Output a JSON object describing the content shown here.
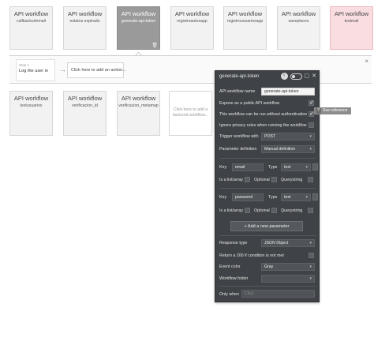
{
  "workflows_row1": [
    {
      "title": "API workflow",
      "name": "callbackurlemail",
      "style": "normal"
    },
    {
      "title": "API workflow",
      "name": "estatus expirado",
      "style": "normal"
    },
    {
      "title": "API workflow",
      "name": "generate-api-token",
      "style": "selected"
    },
    {
      "title": "API workflow",
      "name": "registroautosapp",
      "style": "normal"
    },
    {
      "title": "API workflow",
      "name": "registrousuariosapp",
      "style": "normal"
    },
    {
      "title": "API workflow",
      "name": "saveplaces",
      "style": "normal"
    },
    {
      "title": "API workflow",
      "name": "testmail",
      "style": "pink"
    }
  ],
  "workflows_row2": [
    {
      "title": "API workflow",
      "name": "testusuarios"
    },
    {
      "title": "API workflow",
      "name": "verificacion_id"
    },
    {
      "title": "API workflow",
      "name": "verificacion_metamap"
    }
  ],
  "add_backend_workflow": "Click here to add a backend workflow...",
  "steps_bar": {
    "step_label": "Step 1",
    "step_value": "Log the user in",
    "add_action": "Click here to add an action...",
    "close_glyph": "×"
  },
  "panel": {
    "title": "generate-api-token",
    "api_workflow_name_label": "API workflow name",
    "api_workflow_name_value": "generate-api-token",
    "expose_public_label": "Expose as a public API workflow",
    "expose_public_checked": true,
    "no_auth_label": "This workflow can be run without authentication",
    "no_auth_checked": true,
    "ignore_privacy_label": "Ignore privacy rules when running the workflow",
    "ignore_privacy_checked": false,
    "trigger_label": "Trigger workflow with",
    "trigger_value": "POST",
    "param_def_label": "Parameter definition",
    "param_def_value": "Manual definition",
    "params": [
      {
        "key_label": "Key",
        "key_value": "email",
        "type_label": "Type",
        "type_value": "text",
        "list_label": "Is a list/array",
        "optional_label": "Optional",
        "querystring_label": "Querystring"
      },
      {
        "key_label": "Key",
        "key_value": "password",
        "type_label": "Type",
        "type_value": "text",
        "list_label": "Is a list/array",
        "optional_label": "Optional",
        "querystring_label": "Querystring"
      }
    ],
    "add_param_label": "+ Add a new parameter",
    "response_type_label": "Response type",
    "response_type_value": "JSON Object",
    "return_200_label": "Return a 200 if condition is not met",
    "event_color_label": "Event color",
    "event_color_value": "Gray",
    "folder_label": "Workflow folder",
    "folder_value": "",
    "only_when_label": "Only when",
    "only_when_placeholder": "Click"
  },
  "see_reference": {
    "q": "?",
    "label": "See reference →"
  },
  "colors": {
    "panel_bg": "#3f4246",
    "selected_card": "#9a9a9a",
    "pink_card": "#f9dde1"
  }
}
